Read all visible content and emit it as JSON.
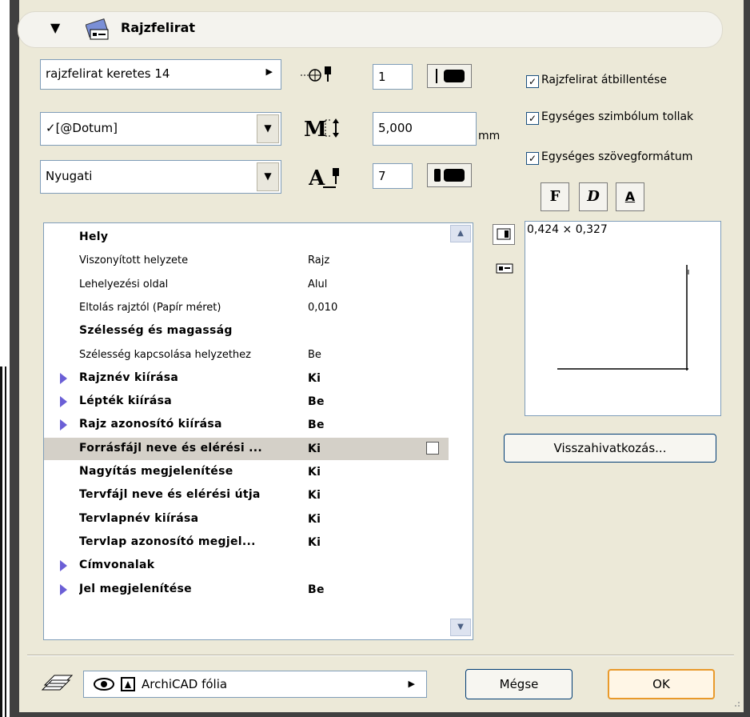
{
  "header": {
    "title": "Rajzfelirat"
  },
  "controls": {
    "marker_popup": "rajzfelirat keretes 14",
    "marker_pen_value": "1",
    "font_popup": "[@Dotum]",
    "font_checkmark": "✓",
    "text_size_value": "5,000",
    "unit_label": "mm",
    "script_popup": "Nyugati",
    "text_pen_value": "7"
  },
  "checkboxes": [
    {
      "label": "Rajzfelirat átbillentése",
      "checked": true
    },
    {
      "label": "Egységes szimbólum tollak",
      "checked": true
    },
    {
      "label": "Egységes szövegformátum",
      "checked": true
    }
  ],
  "style_buttons": [
    "F",
    "D",
    "A"
  ],
  "preview": {
    "size_text": "0,424 × 0,327"
  },
  "settings_rows": [
    {
      "name": "Hely",
      "value": "",
      "bold": true,
      "expandable": false
    },
    {
      "name": "Viszonyított helyzete",
      "value": "Rajz",
      "bold": false,
      "expandable": false
    },
    {
      "name": "Lehelyezési oldal",
      "value": "Alul",
      "bold": false,
      "expandable": false
    },
    {
      "name": "Eltolás rajztól (Papír méret)",
      "value": "0,010",
      "bold": false,
      "expandable": false
    },
    {
      "name": "Szélesség és magasság",
      "value": "",
      "bold": true,
      "expandable": false
    },
    {
      "name": "Szélesség kapcsolása helyzethez",
      "value": "Be",
      "bold": false,
      "expandable": false
    },
    {
      "name": "Rajznév kiírása",
      "value": "Ki",
      "bold": true,
      "expandable": true
    },
    {
      "name": "Lépték kiírása",
      "value": "Be",
      "bold": true,
      "expandable": true
    },
    {
      "name": "Rajz azonosító kiírása",
      "value": "Be",
      "bold": true,
      "expandable": true
    },
    {
      "name": "Forrásfájl neve és elérési ...",
      "value": "Ki",
      "bold": true,
      "expandable": false,
      "selected": true
    },
    {
      "name": "Nagyítás megjelenítése",
      "value": "Ki",
      "bold": true,
      "expandable": false
    },
    {
      "name": "Tervfájl neve és elérési útja",
      "value": "Ki",
      "bold": true,
      "expandable": false
    },
    {
      "name": "Tervlapnév kiírása",
      "value": "Ki",
      "bold": true,
      "expandable": false
    },
    {
      "name": "Tervlap azonosító megjel...",
      "value": "Ki",
      "bold": true,
      "expandable": false
    },
    {
      "name": "Címvonalak",
      "value": "",
      "bold": true,
      "expandable": true
    },
    {
      "name": "Jel megjelenítése",
      "value": "Be",
      "bold": true,
      "expandable": true
    }
  ],
  "buttons": {
    "back_reference": "Visszahivatkozás...",
    "cancel": "Mégse",
    "ok": "OK"
  },
  "layer": {
    "name": "ArchiCAD fólia"
  }
}
